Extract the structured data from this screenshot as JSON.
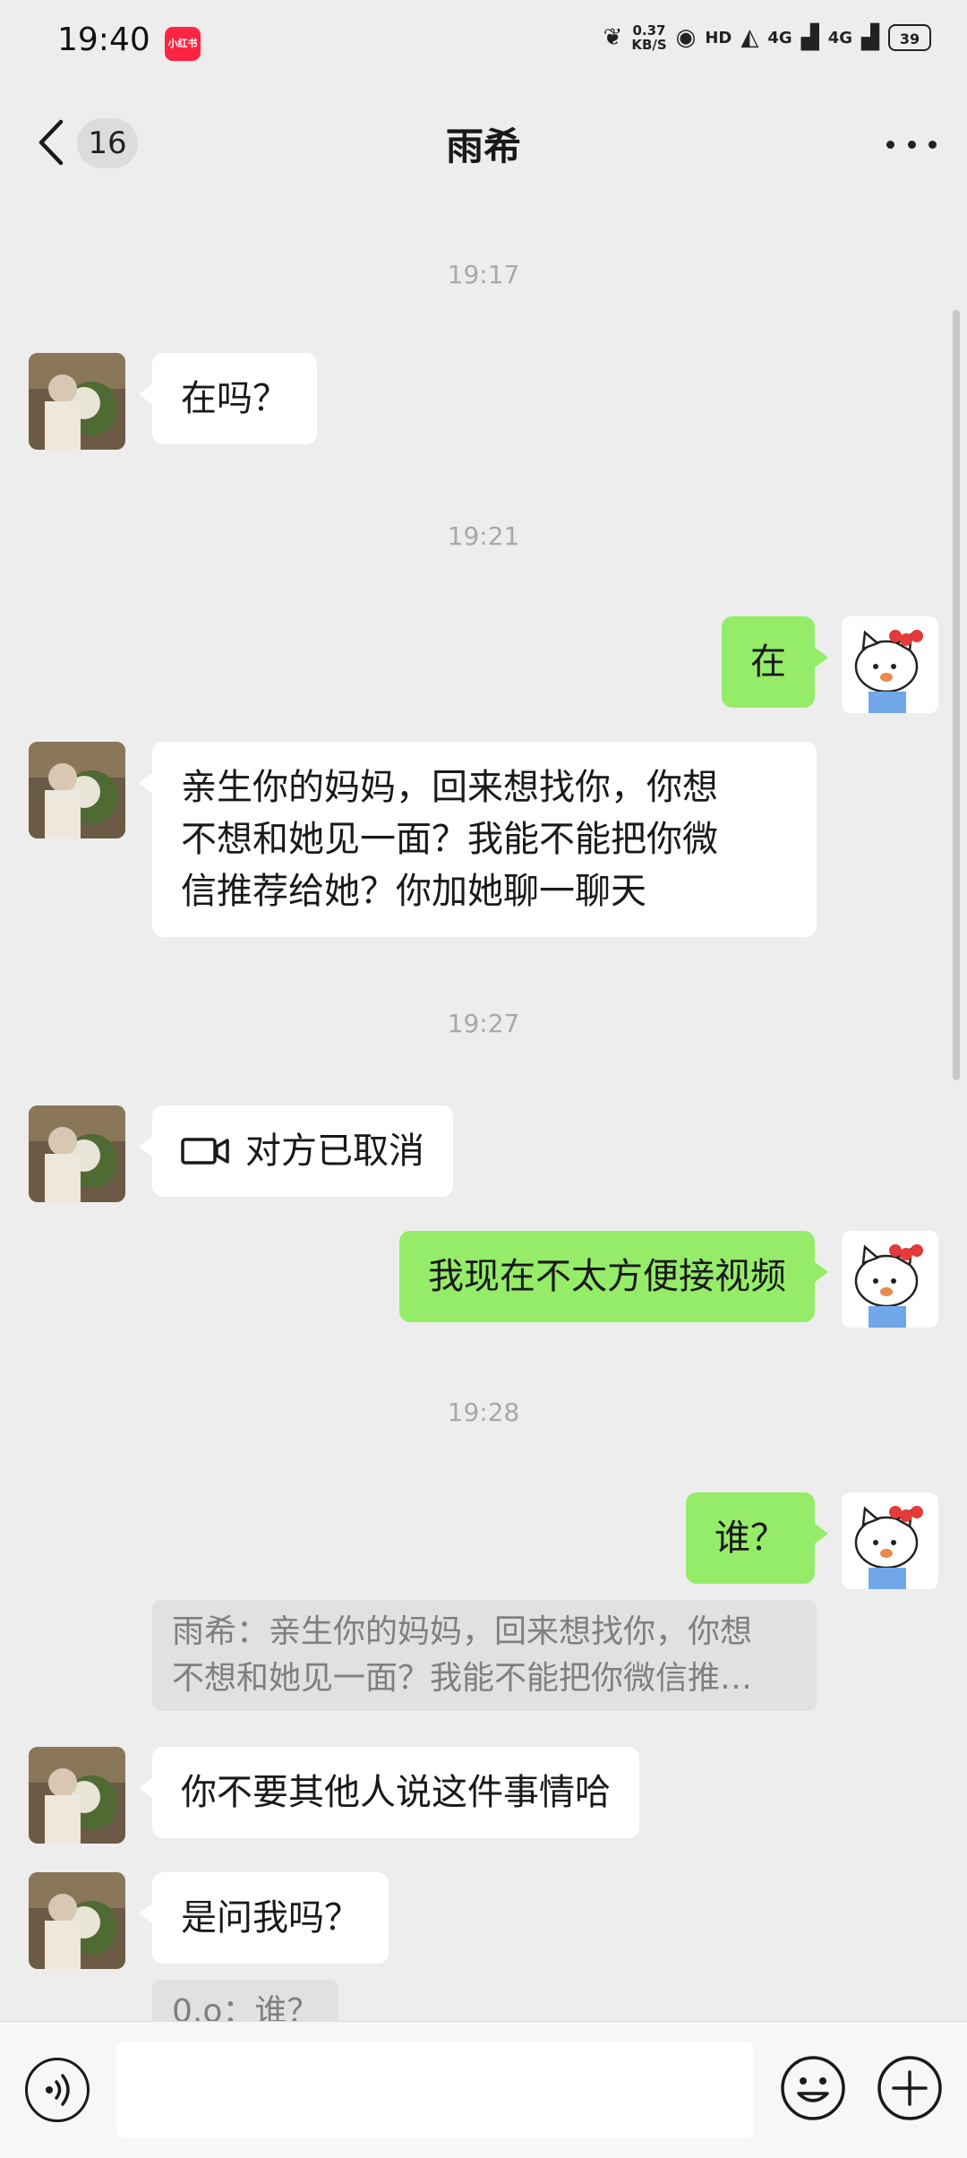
{
  "status_bar": {
    "time": "19:40",
    "app_icon_label": "小红书",
    "speed_value": "0.37",
    "speed_unit": "KB/S",
    "hd_label": "HD",
    "net1": "4G",
    "net2": "4G",
    "battery": "39"
  },
  "nav": {
    "unread_count": "16",
    "title": "雨希"
  },
  "messages": [
    {
      "type": "time",
      "text": "19:17"
    },
    {
      "type": "text",
      "side": "left",
      "text": "在吗？"
    },
    {
      "type": "time",
      "text": "19:21"
    },
    {
      "type": "text",
      "side": "right",
      "text": "在"
    },
    {
      "type": "text",
      "side": "left",
      "lines": [
        "亲生你的妈妈，回来想找你，你想",
        "不想和她见一面？我能不能把你微",
        "信推荐给她？你加她聊一聊天"
      ]
    },
    {
      "type": "time",
      "text": "19:27"
    },
    {
      "type": "video_call",
      "side": "left",
      "text": "对方已取消"
    },
    {
      "type": "text",
      "side": "right",
      "text": "我现在不太方便接视频"
    },
    {
      "type": "time",
      "text": "19:28"
    },
    {
      "type": "text",
      "side": "right",
      "text": "谁？"
    },
    {
      "type": "quote",
      "lines": [
        "雨希：亲生你的妈妈，回来想找你，你想",
        "不想和她见一面？我能不能把你微信推…"
      ]
    },
    {
      "type": "text",
      "side": "left",
      "text": "你不要其他人说这件事情哈"
    },
    {
      "type": "text",
      "side": "left",
      "text": "是问我吗？"
    },
    {
      "type": "quote",
      "text": "0.o：谁？"
    }
  ],
  "icons": {
    "back": "chevron-left-icon",
    "more": "more-dots-icon",
    "video": "video-camera-icon",
    "voice": "voice-icon",
    "emoji": "emoji-icon",
    "plus": "plus-icon"
  },
  "colors": {
    "background": "#EDEDED",
    "bubble_sent": "#95EC69",
    "bubble_received": "#FFFFFF",
    "quote_bg": "#E1E1E1"
  }
}
